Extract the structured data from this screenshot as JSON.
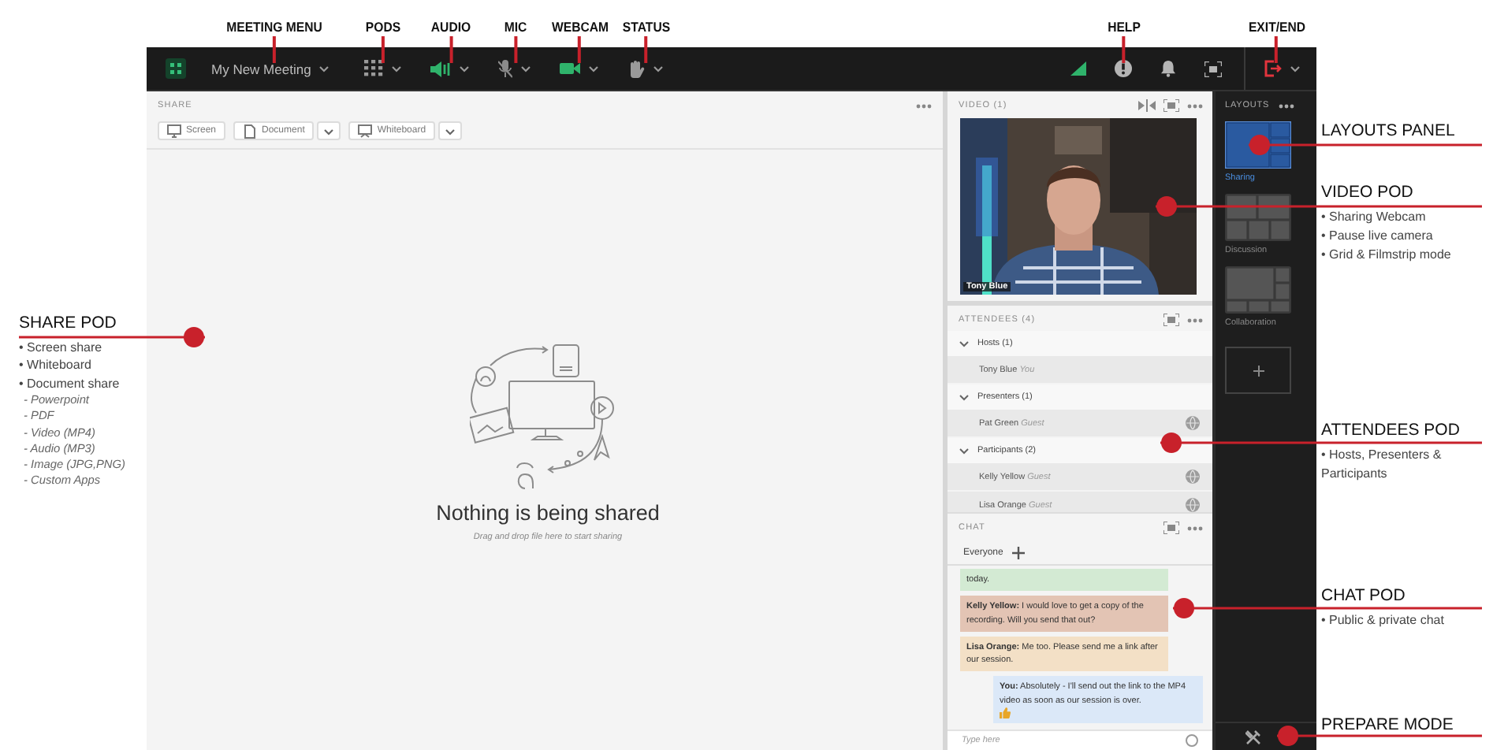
{
  "topbar": {
    "meeting_menu": {
      "label": "My New Meeting",
      "callout": "MEETING MENU"
    },
    "left_controls": [
      {
        "kind": "pods",
        "callout": "PODS"
      },
      {
        "kind": "audio",
        "callout": "AUDIO"
      },
      {
        "kind": "mic",
        "callout": "MIC"
      },
      {
        "kind": "webcam",
        "callout": "WEBCAM"
      },
      {
        "kind": "status",
        "callout": "STATUS"
      }
    ],
    "right_controls": [
      {
        "kind": "signal"
      },
      {
        "kind": "help",
        "callout": "HELP"
      },
      {
        "kind": "bell"
      },
      {
        "kind": "fullscreen"
      },
      {
        "kind": "exit",
        "callout": "EXIT/END"
      }
    ]
  },
  "share_pod": {
    "title": "SHARE",
    "buttons": [
      {
        "label": "Screen",
        "kind": "screen",
        "dropdown": false
      },
      {
        "label": "Document",
        "kind": "document",
        "dropdown": true
      },
      {
        "label": "Whiteboard",
        "kind": "whiteboard",
        "dropdown": true
      }
    ],
    "empty_title": "Nothing is being shared",
    "empty_hint": "Drag and drop file here to start sharing"
  },
  "video_pod": {
    "title": "VIDEO (1)",
    "caption": "Tony Blue"
  },
  "attendees_pod": {
    "title": "ATTENDEES (4)",
    "groups": [
      {
        "label": "Hosts (1)",
        "members": [
          {
            "name": "Tony Blue",
            "role": "You",
            "has_status": false
          }
        ]
      },
      {
        "label": "Presenters (1)",
        "members": [
          {
            "name": "Pat Green",
            "role": "Guest",
            "has_status": true
          }
        ]
      },
      {
        "label": "Participants (2)",
        "members": [
          {
            "name": "Kelly Yellow",
            "role": "Guest",
            "has_status": true
          },
          {
            "name": "Lisa Orange",
            "role": "Guest",
            "has_status": true
          }
        ]
      }
    ]
  },
  "chat_pod": {
    "title": "CHAT",
    "tab": "Everyone",
    "messages": [
      {
        "text": "today.",
        "kind": "other",
        "color": "#d3ead3",
        "thumbs_up": false
      },
      {
        "text": "**Kelly Yellow:** I would love to get a copy of the recording. Will you send that out?",
        "kind": "other",
        "color": "#e3c4b4",
        "thumbs_up": false
      },
      {
        "text": "**Lisa Orange:** Me too. Please send me a link after our session.",
        "kind": "other",
        "color": "#f3e0c6",
        "thumbs_up": false
      },
      {
        "text": "**You:** Absolutely - I'll send out the link to the MP4 video as soon as our session is over.",
        "kind": "own",
        "color": "#dbe8f8",
        "thumbs_up": true
      }
    ],
    "placeholder": "Type here"
  },
  "layouts": {
    "title": "LAYOUTS",
    "items": [
      {
        "label": "Sharing",
        "selected": true,
        "kind": "sharing"
      },
      {
        "label": "Discussion",
        "selected": false,
        "kind": "discussion"
      },
      {
        "label": "Collaboration",
        "selected": false,
        "kind": "collaboration"
      }
    ]
  },
  "left_callout": {
    "title": "SHARE POD",
    "bullets": [
      {
        "text": "• Screen share"
      },
      {
        "text": "• Whiteboard"
      },
      {
        "text": "• Document share",
        "children": [
          {
            "text": "- Powerpoint"
          },
          {
            "text": "- PDF"
          },
          {
            "text": "- Video (MP4)"
          },
          {
            "text": "- Audio (MP3)"
          },
          {
            "text": "- Image (JPG,PNG)"
          },
          {
            "text": "- Custom Apps"
          }
        ]
      }
    ]
  },
  "right_callouts": [
    {
      "title": "LAYOUTS PANEL"
    },
    {
      "title": "VIDEO POD",
      "bullets": [
        "• Sharing Webcam",
        "• Pause live camera",
        "• Grid & Filmstrip mode"
      ]
    },
    {
      "title": "ATTENDEES POD",
      "bullets": [
        "• Hosts, Presenters & Participants"
      ]
    },
    {
      "title": "CHAT POD",
      "bullets": [
        "• Public & private chat"
      ]
    },
    {
      "title": "PREPARE MODE"
    }
  ]
}
